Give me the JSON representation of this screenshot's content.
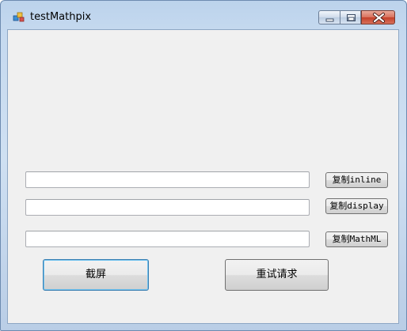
{
  "window": {
    "title": "testMathpix"
  },
  "icons": {
    "app": "app-icon",
    "minimize": "minimize-icon",
    "maximize": "maximize-icon",
    "close": "close-icon"
  },
  "fields": {
    "inline_value": "",
    "display_value": "",
    "mathml_value": ""
  },
  "buttons": {
    "copy_inline": "复制inline",
    "copy_display": "复制display",
    "copy_mathml": "复制MathML",
    "screenshot": "截屏",
    "retry": "重试请求"
  },
  "colors": {
    "client_background": "#f0f0f0",
    "titlebar": "#c5d9ef",
    "close_button": "#c4402a",
    "default_button_border": "#3c7fb1"
  }
}
